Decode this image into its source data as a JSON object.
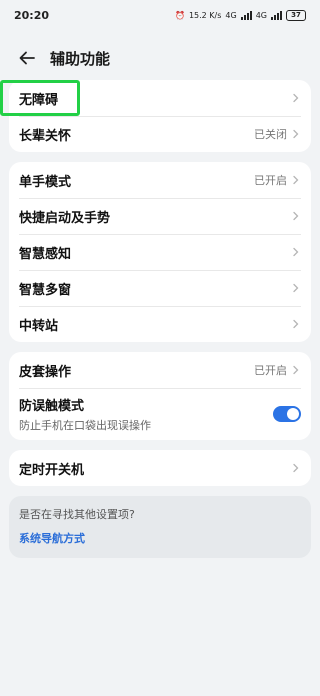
{
  "status": {
    "time": "20:20",
    "net_speed": "15.2 K/s",
    "net1": "4G",
    "net2": "4G",
    "battery": "37"
  },
  "header": {
    "title": "辅助功能"
  },
  "group1": [
    {
      "label": "无障碍",
      "value": ""
    },
    {
      "label": "长辈关怀",
      "value": "已关闭"
    }
  ],
  "group2": [
    {
      "label": "单手模式",
      "value": "已开启"
    },
    {
      "label": "快捷启动及手势",
      "value": ""
    },
    {
      "label": "智慧感知",
      "value": ""
    },
    {
      "label": "智慧多窗",
      "value": ""
    },
    {
      "label": "中转站",
      "value": ""
    }
  ],
  "group3": {
    "cover": {
      "label": "皮套操作",
      "value": "已开启"
    },
    "mistouch": {
      "label": "防误触模式",
      "desc": "防止手机在口袋出现误操作",
      "enabled": true
    }
  },
  "group4": [
    {
      "label": "定时开关机",
      "value": ""
    }
  ],
  "suggest": {
    "question": "是否在寻找其他设置项?",
    "link": "系统导航方式"
  },
  "colors": {
    "accent": "#2b73e5",
    "highlight": "#22d046",
    "background": "#f1f3f5"
  }
}
